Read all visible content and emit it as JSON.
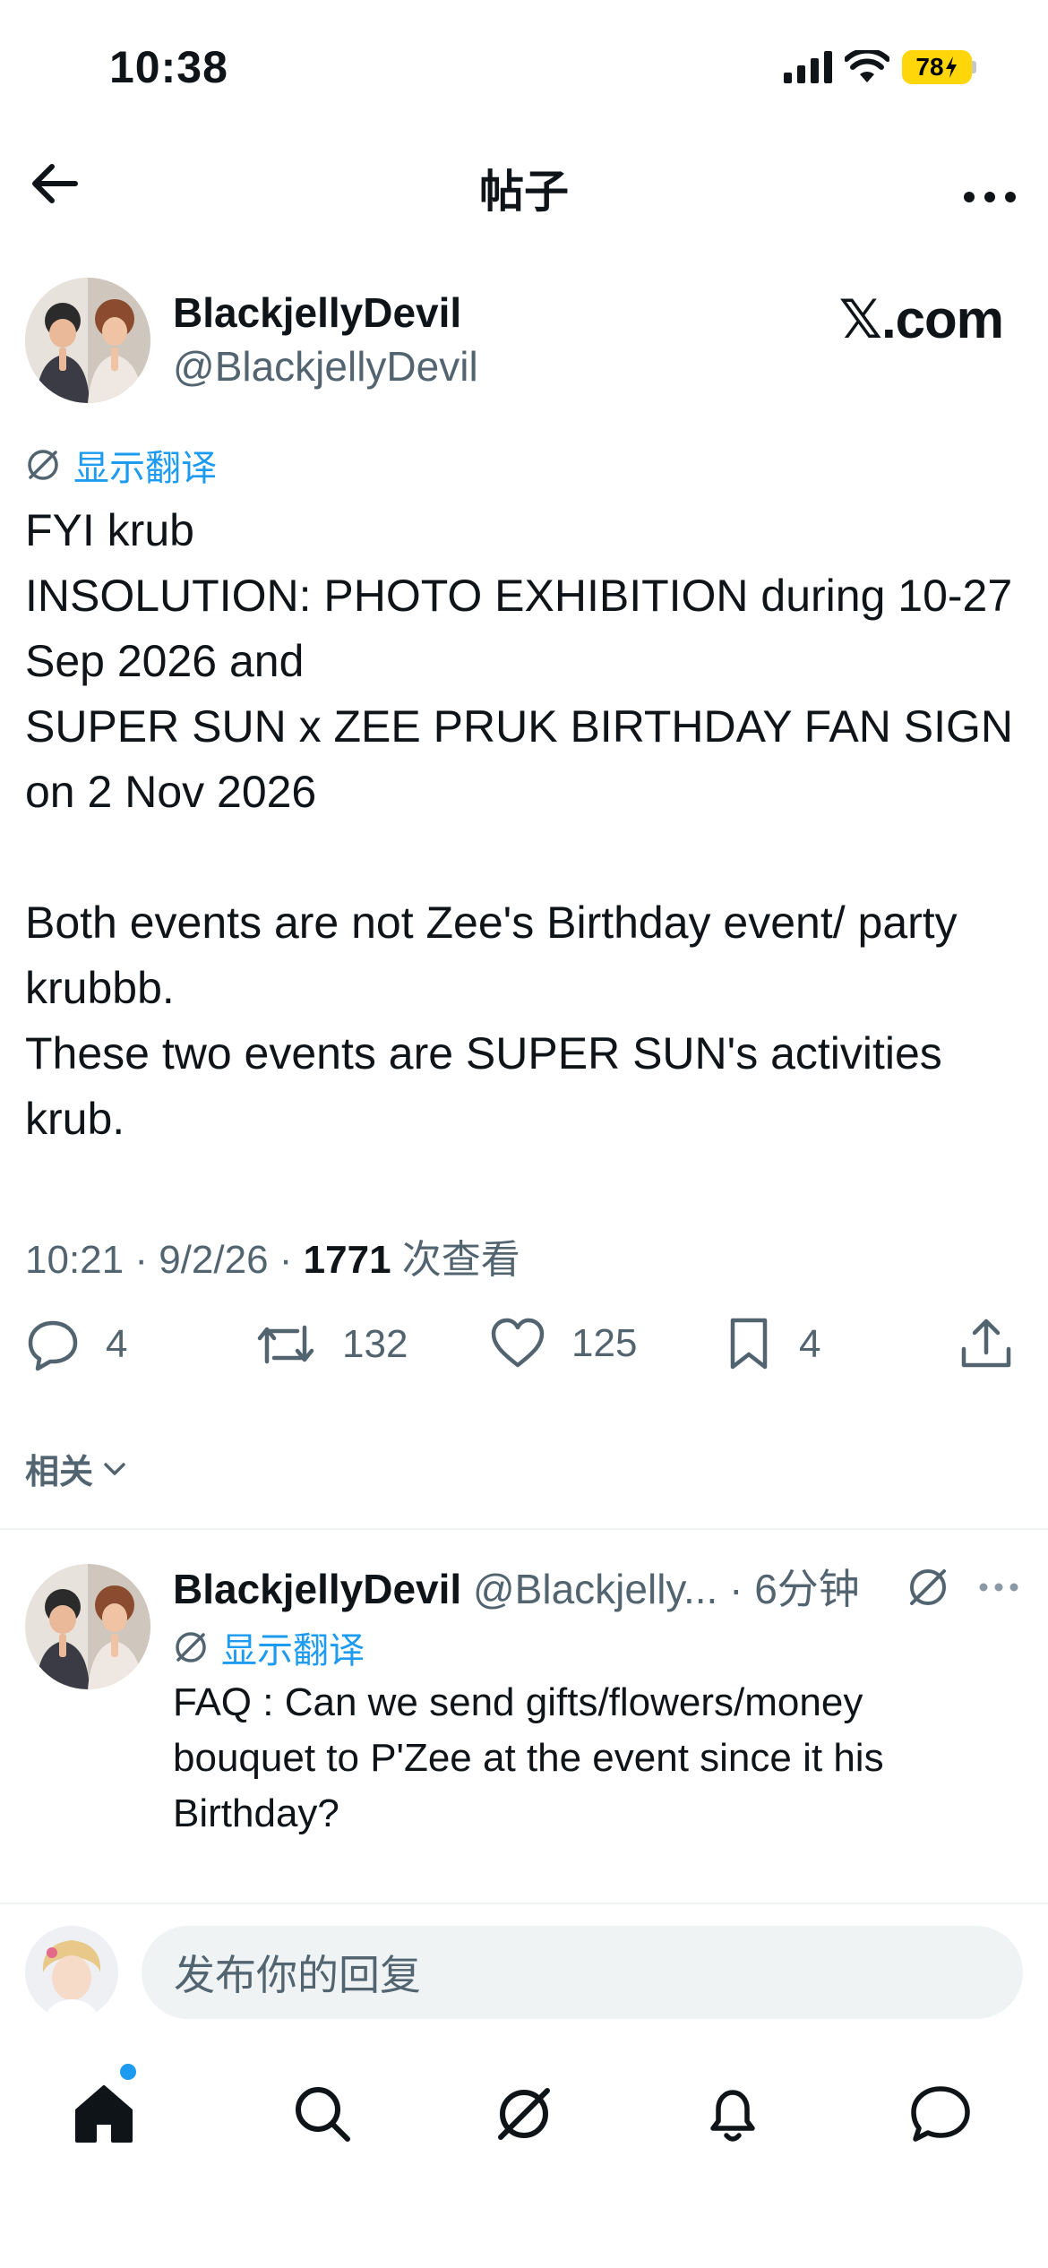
{
  "status_bar": {
    "time": "10:38",
    "battery": "78"
  },
  "nav": {
    "title": "帖子"
  },
  "post": {
    "author_name": "BlackjellyDevil",
    "author_handle": "@BlackjellyDevil",
    "watermark": "𝕏.com",
    "translate_label": "显示翻译",
    "text": "FYI krub\nINSOLUTION: PHOTO EXHIBITION during 10-27 Sep 2026 and\nSUPER SUN x ZEE PRUK BIRTHDAY FAN SIGN on 2 Nov 2026\n\nBoth events are not Zee's Birthday event/ party krubbb.\nThese two events are SUPER SUN's activities krub.",
    "meta_time": "10:21 · 9/2/26 · ",
    "views_count": "1771",
    "views_label": " 次查看",
    "replies": "4",
    "reposts": "132",
    "likes": "125",
    "bookmarks": "4"
  },
  "related_label": "相关",
  "reply": {
    "author_name": "BlackjellyDevil",
    "author_handle": "@Blackjelly...",
    "time": " · 6分钟",
    "translate_label": "显示翻译",
    "text": "FAQ : Can we send gifts/flowers/money bouquet to P'Zee at the event since it his Birthday?"
  },
  "composer": {
    "placeholder": "发布你的回复"
  },
  "icons": {
    "back": "arrow-left-icon",
    "more": "ellipsis-icon",
    "translate": "grok-icon",
    "reply": "reply-icon",
    "repost": "repost-icon",
    "like": "heart-icon",
    "bookmark": "bookmark-icon",
    "share": "share-icon",
    "tabs": [
      "home-icon",
      "search-icon",
      "grok-icon",
      "bell-icon",
      "messages-icon"
    ]
  },
  "colors": {
    "accent": "#1d9bf0",
    "muted": "#536471",
    "text": "#0f1419",
    "battery": "#ffd60a"
  }
}
